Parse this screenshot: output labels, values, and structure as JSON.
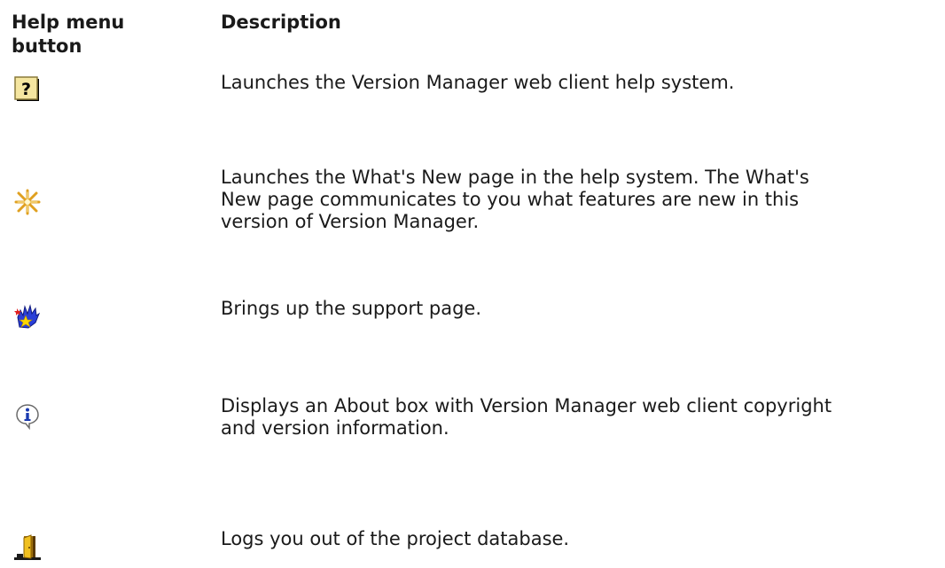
{
  "headers": {
    "button": "Help menu button",
    "description": "Description"
  },
  "rows": [
    {
      "icon": "help-question-icon",
      "description": "Launches the Version Manager web client help system."
    },
    {
      "icon": "whats-new-sparkle-icon",
      "description": "Launches the What's New page in the help system. The What's\nNew page communicates to you what features are new in this\nversion of Version Manager."
    },
    {
      "icon": "support-hand-icon",
      "description": "Brings up the support page."
    },
    {
      "icon": "about-info-icon",
      "description": "Displays an About box with Version Manager web client copyright\nand version information."
    },
    {
      "icon": "logout-door-icon",
      "description": "Logs you out of the project database."
    }
  ]
}
